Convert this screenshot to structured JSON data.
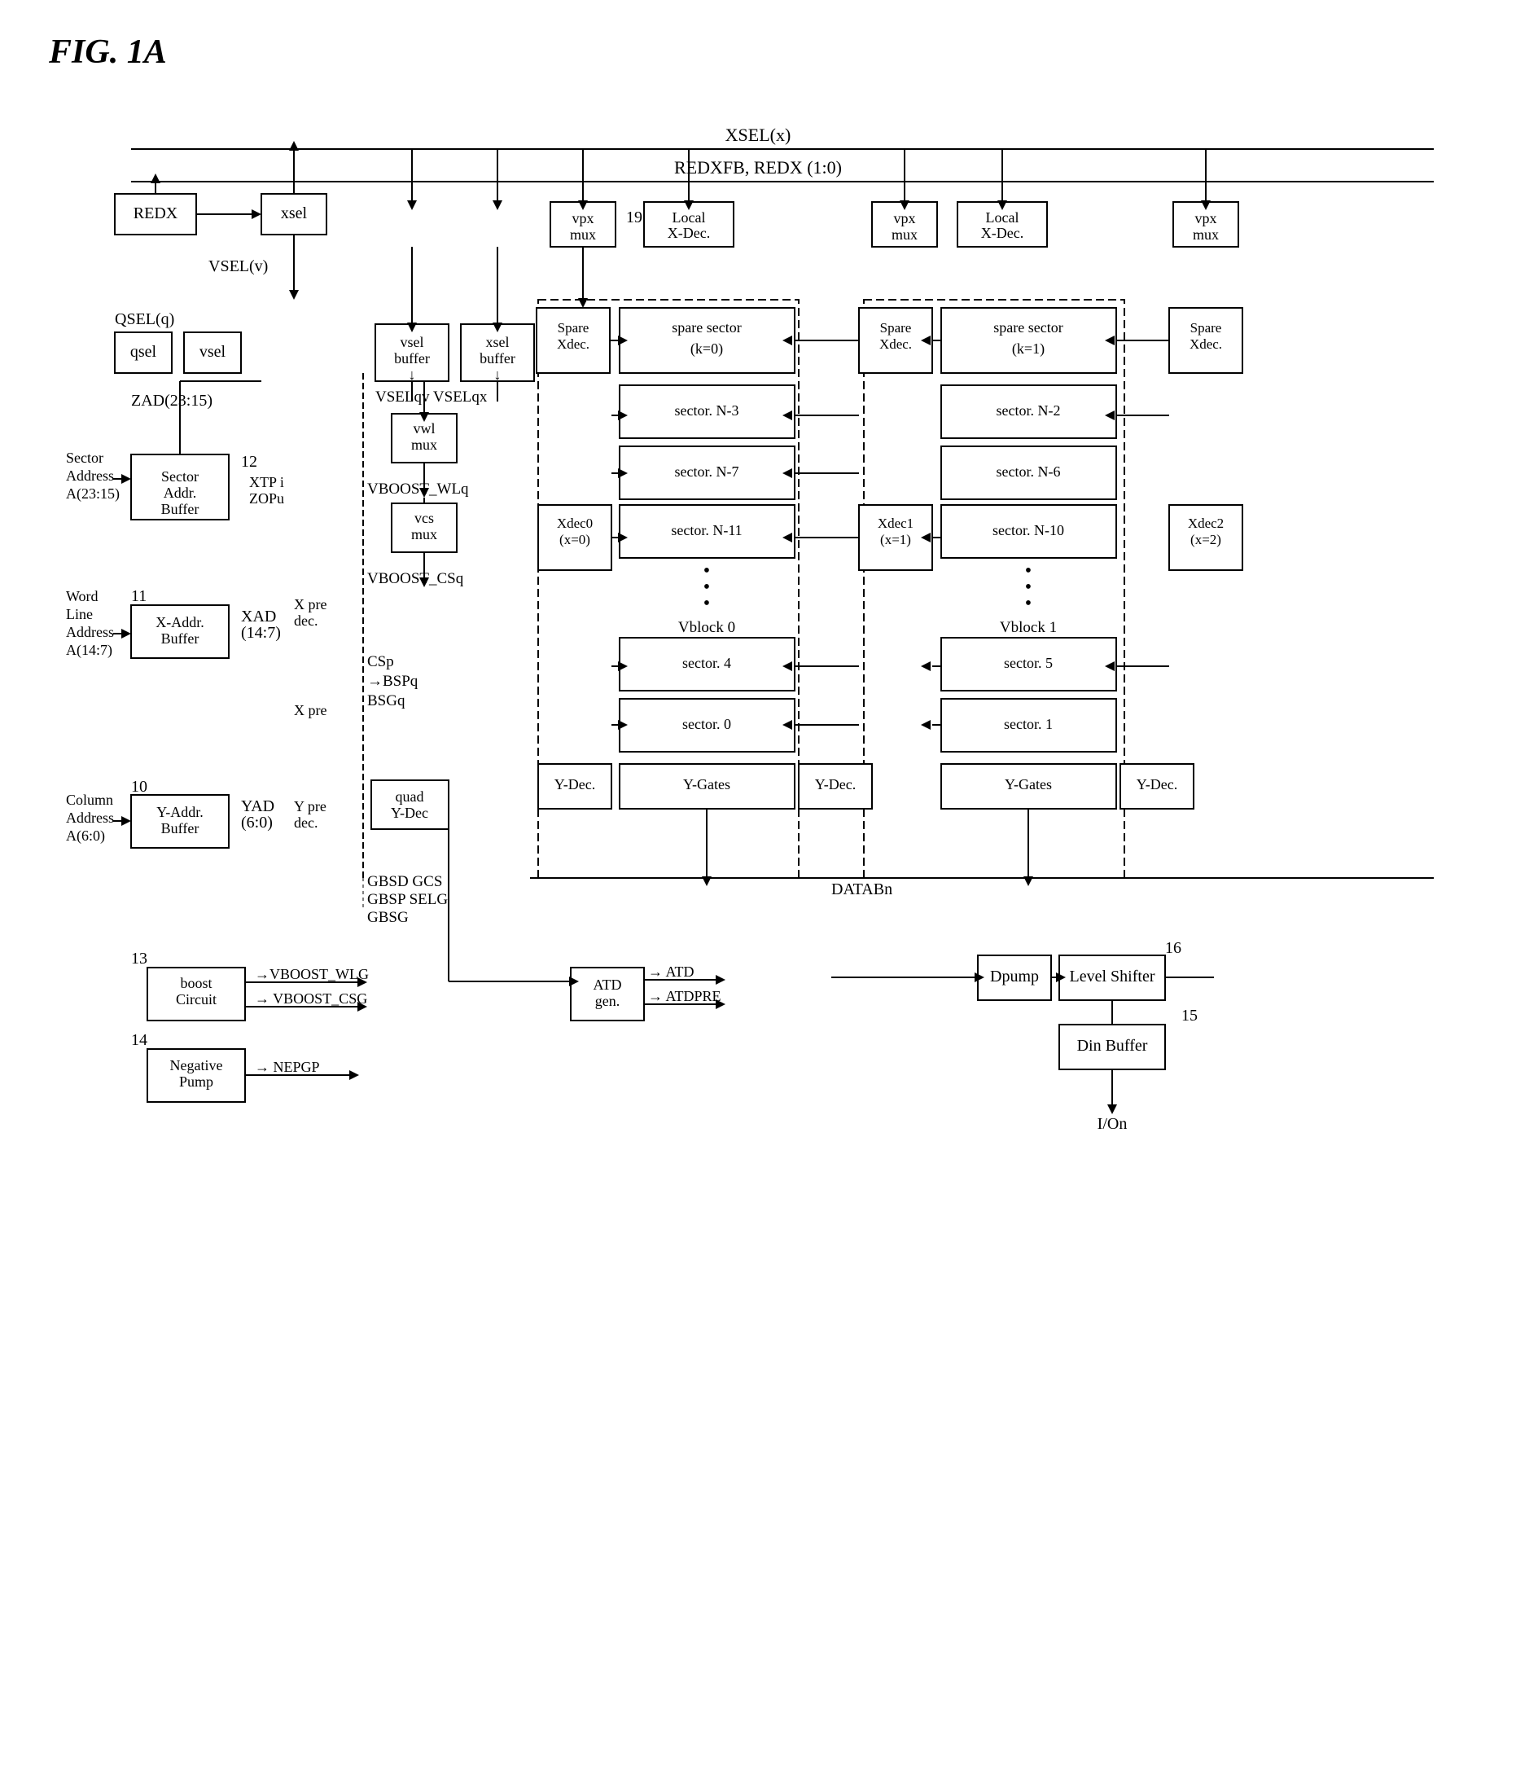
{
  "figure": {
    "title": "FIG. 1A"
  },
  "blocks": {
    "redx": "REDX",
    "xsel": "xsel",
    "qsel": "qsel",
    "vsel": "vsel",
    "sector_addr_buffer": "Sector Addr. Buffer",
    "xaddr_buffer": "X-Addr. Buffer",
    "yaddr_buffer": "Y-Addr. Buffer",
    "vsel_buffer": "vsel buffer",
    "xsel_buffer": "xsel buffer",
    "vpx_mux1": "vpx mux",
    "vpx_mux2": "vpx mux",
    "vpx_mux3": "vpx mux",
    "local_xdec1": "Local X-Dec.",
    "local_xdec2": "Local X-Dec.",
    "spare_xdec1": "Spare Xdec.",
    "spare_xdec2": "Spare Xdec.",
    "spare_xdec3": "Spare Xdec.",
    "spare_sector_k0": "spare sector (k=0)",
    "spare_sector_k1": "spare sector (k=1)",
    "sector_N3": "sector. N-3",
    "sector_N7": "sector. N-7",
    "sector_N11": "sector. N-11",
    "sector_N2": "sector. N-2",
    "sector_N6": "sector. N-6",
    "sector_N10": "sector. N-10",
    "sector_4": "sector. 4",
    "sector_5": "sector. 5",
    "sector_0": "sector. 0",
    "sector_1": "sector. 1",
    "xdec0": "Xdec0 (x=0)",
    "xdec1": "Xdec1 (x=1)",
    "xdec2": "Xdec2 (x=2)",
    "vwl_mux": "vwl mux",
    "vcs_mux": "vcs mux",
    "quad_ydec": "quad Y-Dec",
    "ydec1": "Y-Dec.",
    "ydec2": "Y-Dec.",
    "ydec3": "Y-Dec.",
    "ygates1": "Y-Gates",
    "ygates2": "Y-Gates",
    "boost_circuit": "boost Circuit",
    "negative_pump": "Negative Pump",
    "atd_gen": "ATD gen.",
    "dpump": "Dpump",
    "level_shifter": "Level Shifter",
    "din_buffer": "Din Buffer"
  },
  "labels": {
    "xsel_x": "XSEL(x)",
    "redxfb": "REDXFB, REDX (1:0)",
    "vsel_v": "VSEL(v)",
    "qsel_q": "QSEL(q)",
    "zad": "ZAD(23:15)",
    "sector_address": "Sector Address A(23:15)",
    "xtp_zopu": "XTP i ZOPu",
    "xad": "XAD (14:7)",
    "word_line": "Word Line Address A(14:7)",
    "column_address": "Column Address A(6:0)",
    "yad": "YAD (6:0)",
    "vselqv": "VSELqv",
    "vselqx": "VSELqx",
    "vboost_wlq": "VBOOST_WLq",
    "vboost_csq": "VBOOST_CSq",
    "csp": "CSp",
    "bspq": "→BSPq",
    "bsgq": "BSGq",
    "gbsd_gcs": "GBSD GCS",
    "gbsp_selg": "GBSP SELG",
    "gbsg": "GBSG",
    "vboost_wlg": "→VBOOST_WLG",
    "vboost_csg": "→ VBOOST_CSG",
    "nepgp": "→ NEPGP",
    "atd_arrow": "→ ATD",
    "atdpre": "→ ATDPRE",
    "databN": "DATABn",
    "io_n": "I/On",
    "vblock0": "Vblock 0",
    "vblock1": "Vblock 1",
    "num19": "19",
    "num10": "10",
    "num11": "11",
    "num12": "12",
    "num13": "13",
    "num14": "14",
    "num15": "15",
    "num16": "16",
    "xpredec": "X pre dec.",
    "xpre": "X pre",
    "ypredec": "Y pre dec."
  }
}
